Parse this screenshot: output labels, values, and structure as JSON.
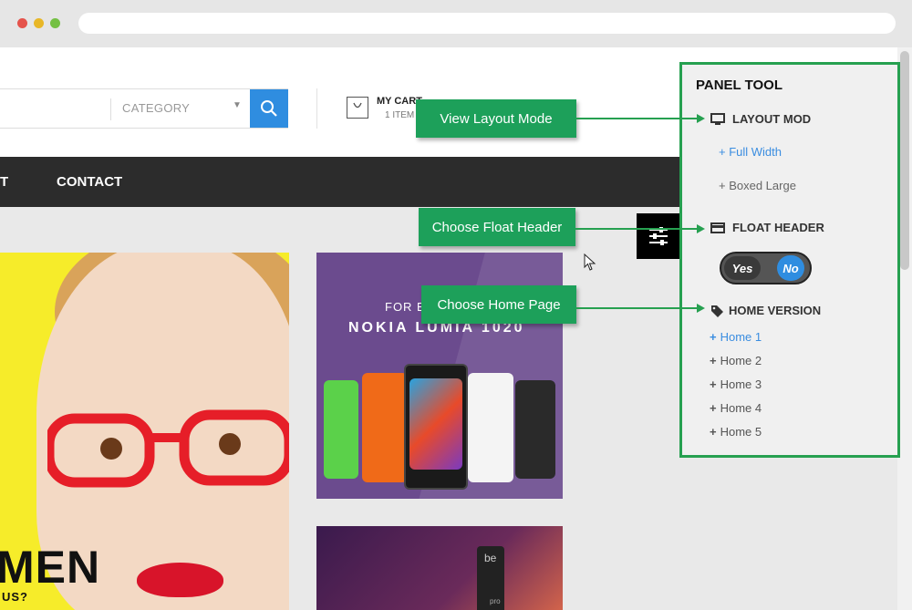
{
  "header": {
    "category_label": "CATEGORY",
    "cart_title": "MY CART",
    "cart_items": "1 ITEM"
  },
  "nav": {
    "partial_item": "T",
    "contact": "CONTACT"
  },
  "banners": {
    "women_partial": "MEN",
    "women_sub": "US?",
    "nokia_for": "FOR B",
    "nokia_title": "NOKIA LUMIA 1020",
    "beats_text": "be",
    "beats_small": "pro"
  },
  "panel": {
    "title": "PANEL TOOL",
    "layout": {
      "heading": "LAYOUT MOD",
      "icon": "monitor-icon",
      "options": [
        "+ Full Width",
        "+ Boxed Large"
      ]
    },
    "float_header": {
      "heading": "FLOAT HEADER",
      "icon": "header-card-icon",
      "yes": "Yes",
      "no": "No",
      "selected": "No"
    },
    "home_version": {
      "heading": "HOME VERSION",
      "icon": "tags-icon",
      "items": [
        "Home 1",
        "Home 2",
        "Home 3",
        "Home 4",
        "Home 5"
      ],
      "active": "Home 1"
    }
  },
  "callouts": {
    "layout": "View Layout Mode",
    "float": "Choose Float Header",
    "home": "Choose Home Page"
  },
  "colors": {
    "accent_blue": "#2f8de0",
    "callout_green": "#1da05a",
    "panel_border": "#26a050",
    "nav_bg": "#2c2c2c"
  }
}
